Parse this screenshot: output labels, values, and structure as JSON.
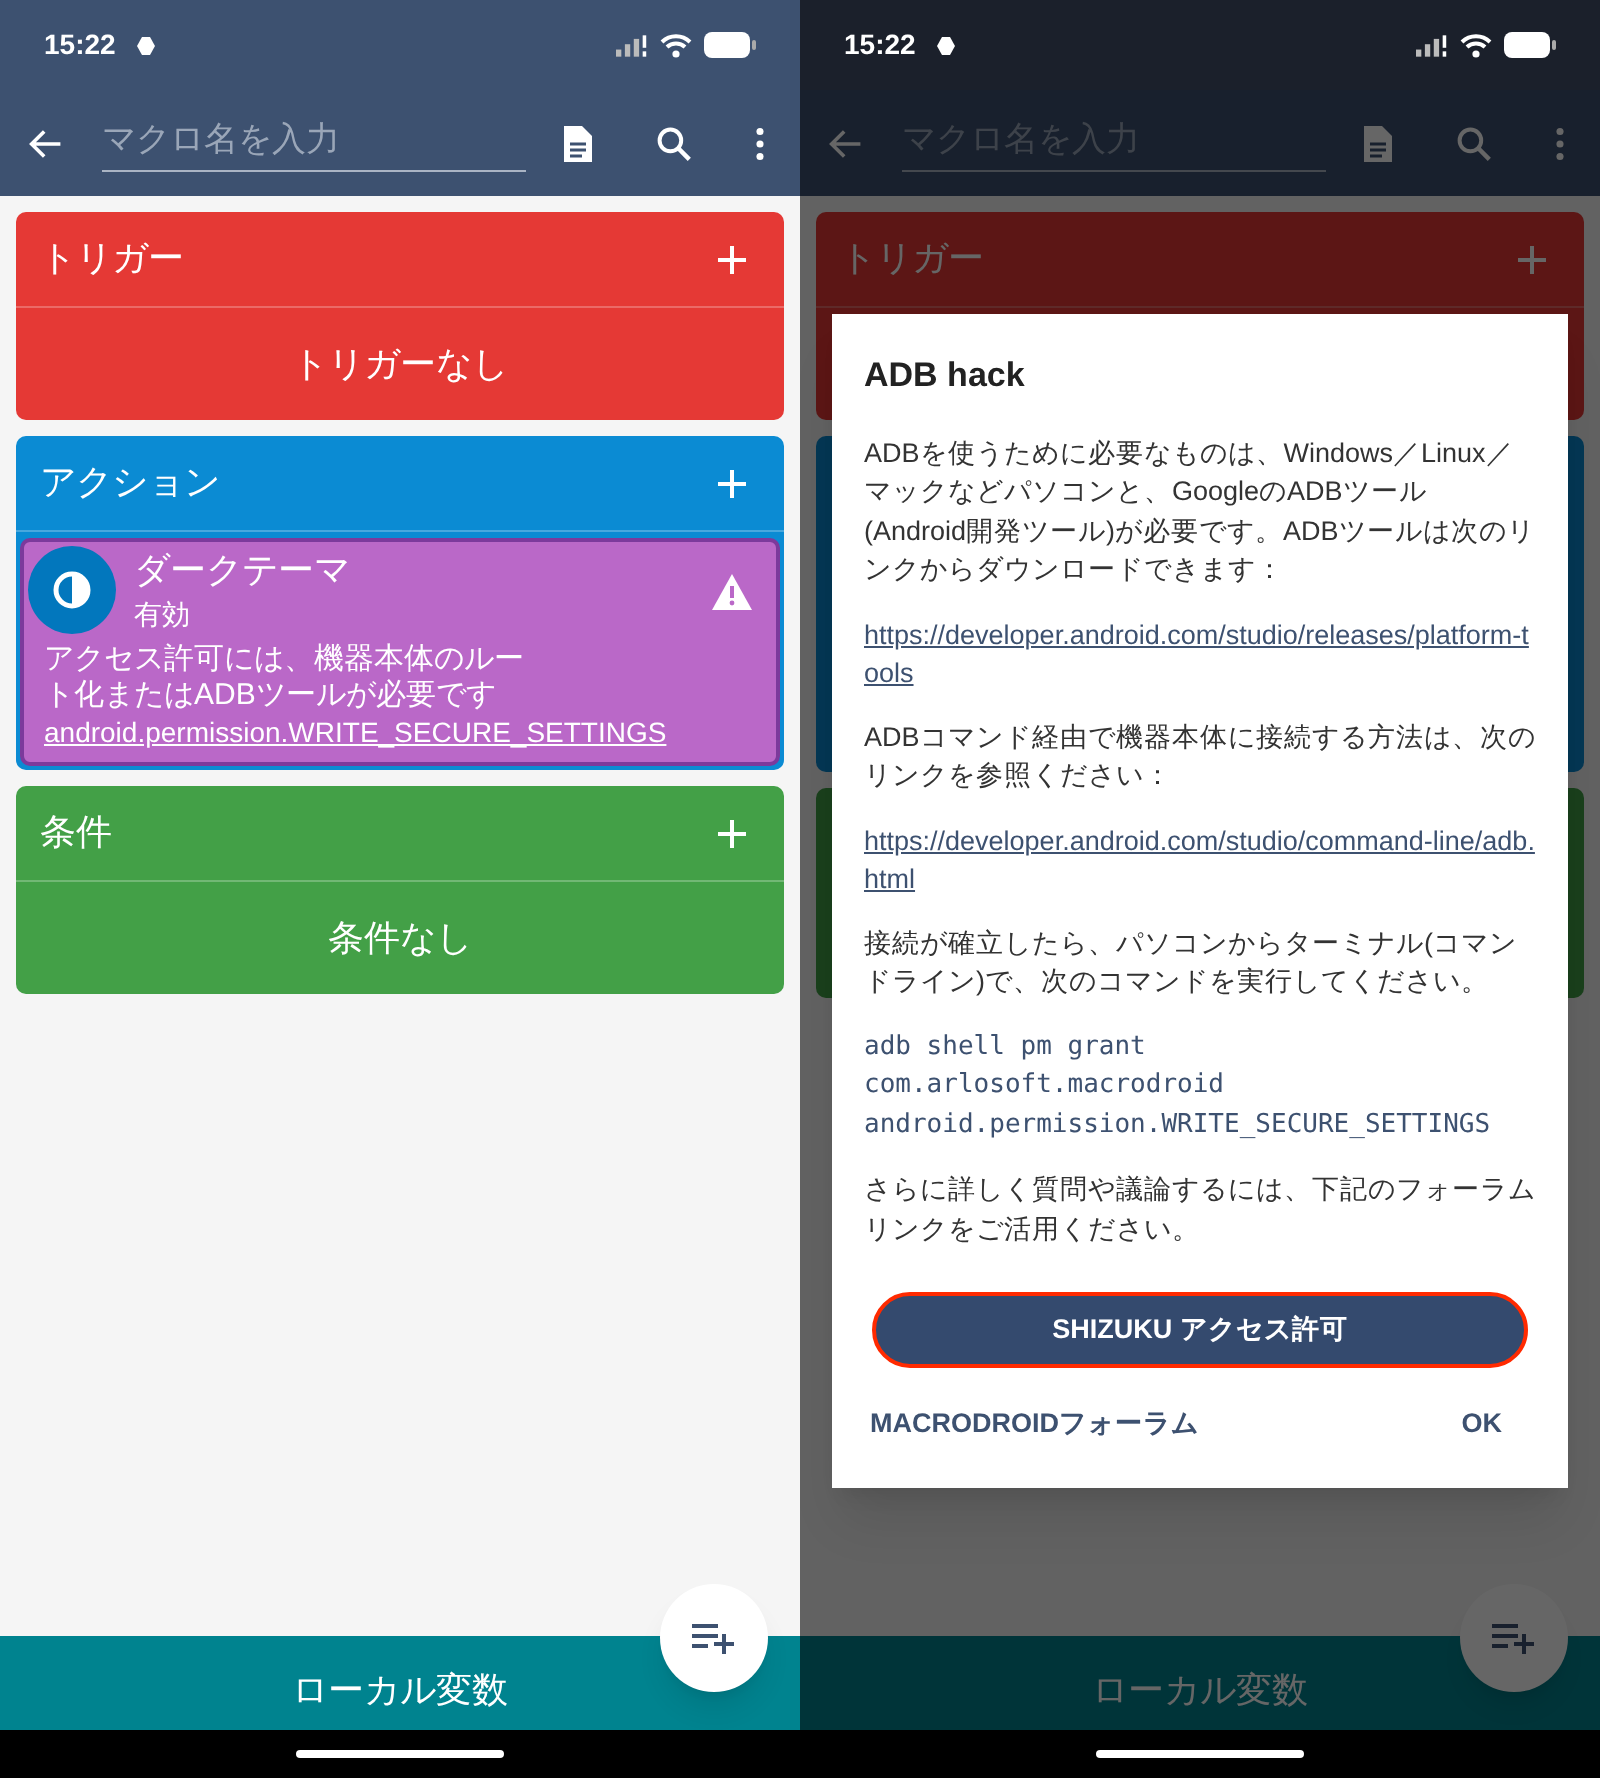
{
  "screens": [
    {
      "status_bar": {
        "time": "15:22"
      },
      "toolbar": {
        "placeholder": "マクロ名を入力"
      },
      "sections": [
        {
          "kind": "trigger",
          "title": "トリガー",
          "empty_text": "トリガーなし"
        },
        {
          "kind": "action",
          "title": "アクション",
          "items": [
            {
              "title": "ダークテーマ",
              "subtitle": "有効",
              "description": "アクセス許可には、機器本体のルート化またはADBツールが必要です",
              "link": "android.permission.WRITE_SECURE_SETTINGS",
              "warning": true
            }
          ]
        },
        {
          "kind": "condition",
          "title": "条件",
          "empty_text": "条件なし"
        }
      ],
      "bottom_bar": {
        "label": "ローカル変数"
      },
      "dimmed": false
    },
    {
      "status_bar": {
        "time": "15:22"
      },
      "toolbar": {
        "placeholder": "マクロ名を入力"
      },
      "sections": [
        {
          "kind": "trigger",
          "title": "トリガー"
        },
        {
          "kind": "action"
        },
        {
          "kind": "condition"
        }
      ],
      "bottom_bar": {
        "label": "ローカル変数"
      },
      "dimmed": true,
      "dialog": {
        "title": "ADB hack",
        "body": [
          {
            "kind": "text",
            "text": "ADBを使うために必要なものは、Windows／Linux／マックなどパソコンと、GoogleのADBツール (Android開発ツール)が必要です。ADBツールは次のリンクからダウンロードできます："
          },
          {
            "kind": "link",
            "text": "https://developer.android.com/studio/releases/platform-tools"
          },
          {
            "kind": "text",
            "text": "ADBコマンド経由で機器本体に接続する方法は、次のリンクを参照ください："
          },
          {
            "kind": "link",
            "text": "https://developer.android.com/studio/command-line/adb.html"
          },
          {
            "kind": "text",
            "text": "接続が確立したら、パソコンからターミナル(コマンドライン)で、次のコマンドを実行してください。"
          },
          {
            "kind": "code",
            "text": "adb shell pm grant\ncom.arlosoft.macrodroid\nandroid.permission.WRITE_SECURE_SETTINGS"
          },
          {
            "kind": "text",
            "text": "さらに詳しく質問や議論するには、下記のフォーラムリンクをご活用ください。"
          }
        ],
        "primary_button": {
          "label": "SHIZUKU アクセス許可",
          "highlighted": true
        },
        "buttons": [
          "MACRODROIDフォーラム",
          "OK"
        ]
      }
    }
  ]
}
